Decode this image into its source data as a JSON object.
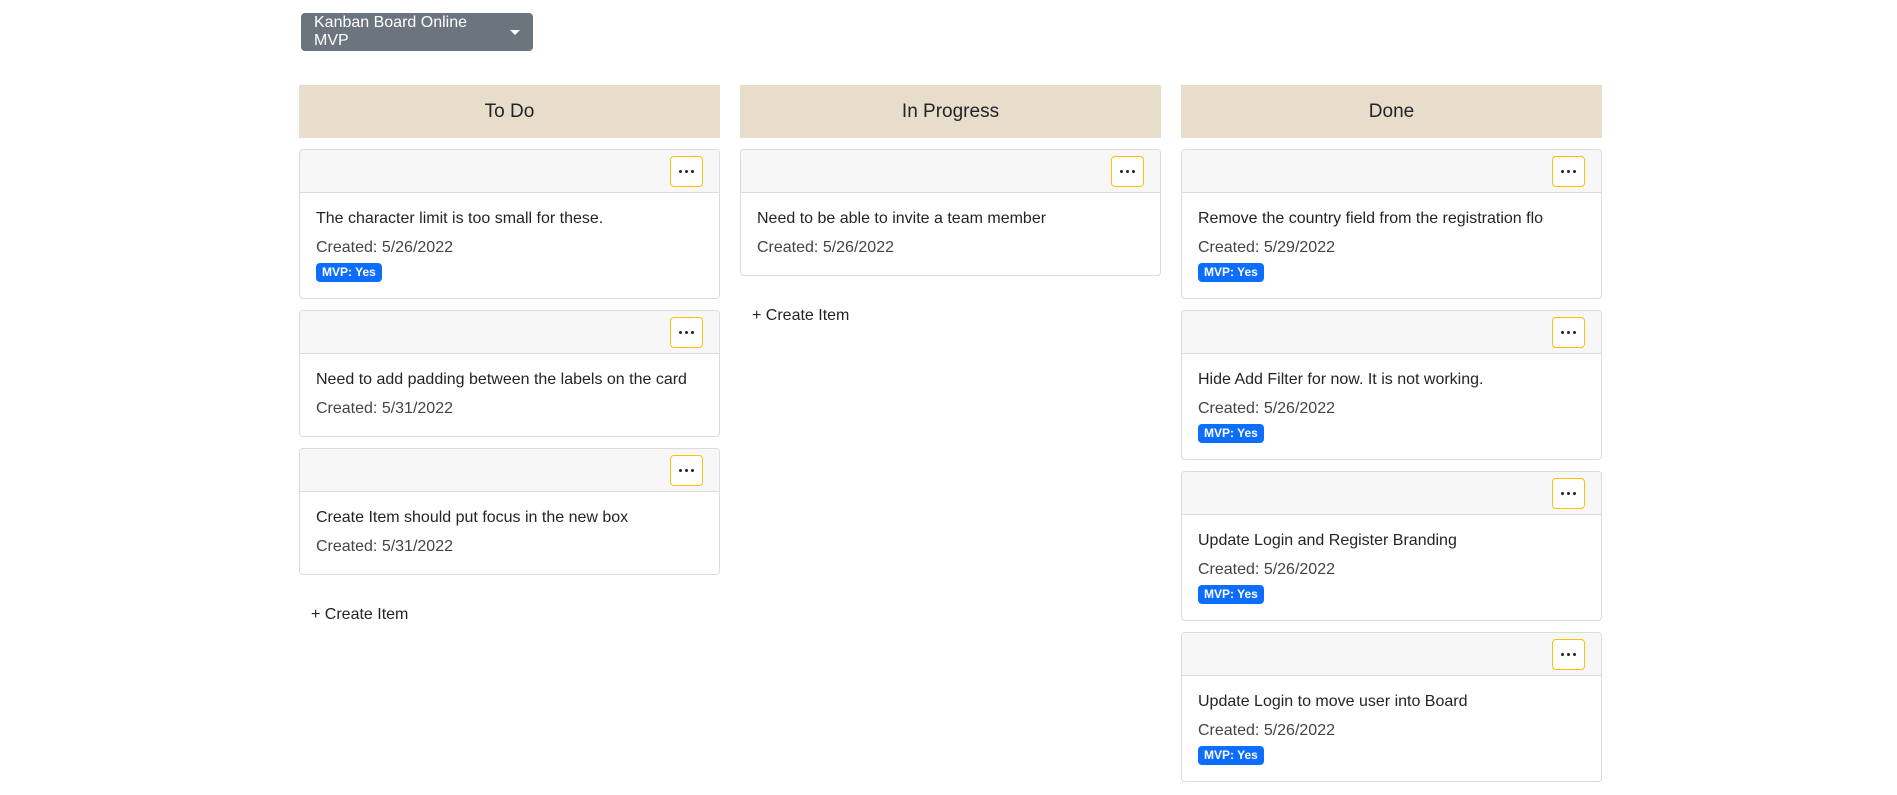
{
  "board_selector": {
    "label": "Kanban Board Online MVP",
    "icon": "caret-down-icon"
  },
  "menu_icon": "ellipsis-icon",
  "columns": [
    {
      "title": "To Do",
      "cards": [
        {
          "title": "The character limit is too small for these.",
          "created": "Created: 5/26/2022",
          "badge": "MVP: Yes"
        },
        {
          "title": "Need to add padding between the labels on the card",
          "created": "Created: 5/31/2022",
          "badge": null
        },
        {
          "title": "Create Item should put focus in the new box",
          "created": "Created: 5/31/2022",
          "badge": null
        }
      ],
      "create_label": "+ Create Item"
    },
    {
      "title": "In Progress",
      "cards": [
        {
          "title": "Need to be able to invite a team member",
          "created": "Created: 5/26/2022",
          "badge": null
        }
      ],
      "create_label": "+ Create Item"
    },
    {
      "title": "Done",
      "cards": [
        {
          "title": "Remove the country field from the registration flo",
          "created": "Created: 5/29/2022",
          "badge": "MVP: Yes"
        },
        {
          "title": "Hide Add Filter for now. It is not working.",
          "created": "Created: 5/26/2022",
          "badge": "MVP: Yes"
        },
        {
          "title": "Update Login and Register Branding",
          "created": "Created: 5/26/2022",
          "badge": "MVP: Yes"
        },
        {
          "title": "Update Login to move user into Board",
          "created": "Created: 5/26/2022",
          "badge": "MVP: Yes"
        }
      ],
      "create_label": null
    }
  ],
  "colors": {
    "column_header": "#e8dccb",
    "dropdown": "#6c757d",
    "badge": "#0d6efd",
    "menu_border": "#ffc107"
  }
}
